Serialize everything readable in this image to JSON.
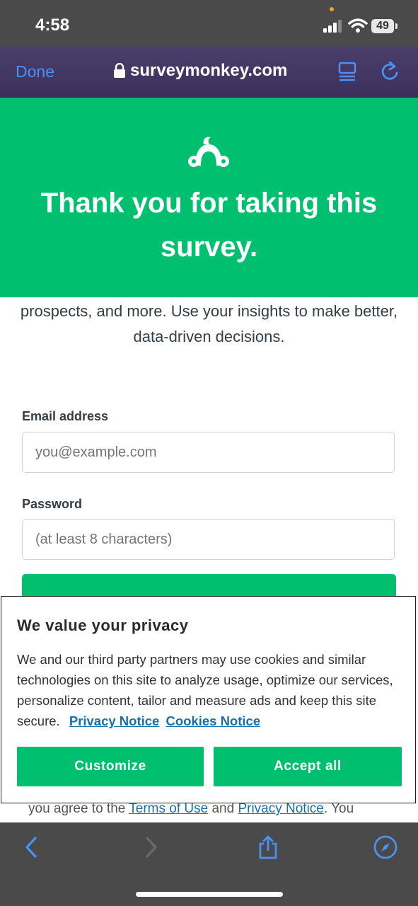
{
  "status_bar": {
    "time": "4:58",
    "battery": "49"
  },
  "safari": {
    "done_label": "Done",
    "url": "surveymonkey.com"
  },
  "hero": {
    "title": "Thank you for taking this survey."
  },
  "body": {
    "lead_text": "prospects, and more. Use your insights to make better, data-driven decisions."
  },
  "form": {
    "email_label": "Email address",
    "email_placeholder": "you@example.com",
    "password_label": "Password",
    "password_placeholder": "(at least 8 characters)"
  },
  "consent": {
    "title": "We value your privacy",
    "body": "We and our third party partners may use cookies and similar technologies on this site to analyze usage, optimize our services, personalize content, tailor and measure ads and keep this site secure.",
    "privacy_link": "Privacy Notice",
    "cookies_link": "Cookies Notice",
    "customize_label": "Customize",
    "accept_label": "Accept all"
  },
  "footer": {
    "prefix": "you agree to the ",
    "terms_link": "Terms of Use",
    "middle": " and ",
    "privacy_link": "Privacy Notice",
    "suffix": ". You"
  },
  "colors": {
    "brand_green": "#00bf6f",
    "link_blue": "#1a6fa8",
    "safari_blue": "#4a90f5"
  },
  "icons": [
    "lock-icon",
    "reader-icon",
    "reload-icon",
    "surveymonkey-logo",
    "back-icon",
    "forward-icon",
    "share-icon",
    "compass-icon"
  ]
}
